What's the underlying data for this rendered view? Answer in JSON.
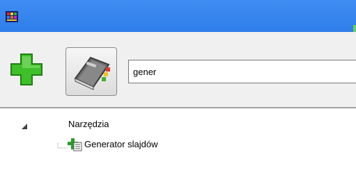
{
  "toolbar": {
    "search": {
      "value": "gener"
    }
  },
  "tree": {
    "nodes": [
      {
        "label": "Narzędzia",
        "expanded": true,
        "children": [
          {
            "label": "Generator slajdów"
          }
        ]
      }
    ]
  },
  "icons": {
    "app": "app-icon",
    "add": "plus-icon",
    "book": "notebook-icon",
    "expander": "expanded-triangle-icon",
    "tool": "slide-generator-icon"
  },
  "colors": {
    "titlebar": "#3584ee",
    "toolbar_bg": "#f0f0f0",
    "add_green": "#3fbf2a"
  }
}
